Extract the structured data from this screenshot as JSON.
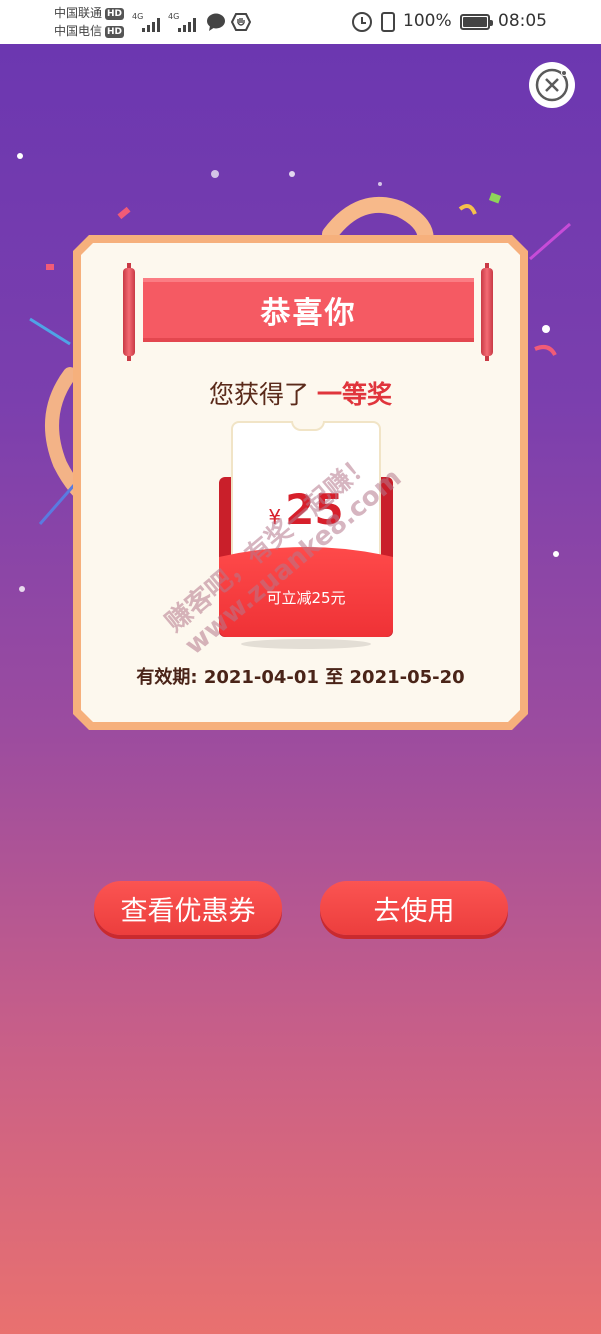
{
  "status_bar": {
    "carrier_1": "中国联通",
    "carrier_2": "中国电信",
    "hd_badge": "HD",
    "network_1": "4G",
    "network_2": "4G",
    "battery_percent": "100%",
    "time": "08:05",
    "icons": [
      "signal-icon",
      "signal-icon",
      "message-icon",
      "shield-icon",
      "alarm-icon",
      "vibrate-icon",
      "battery-icon"
    ]
  },
  "dialog": {
    "banner_title": "恭喜你",
    "prize_prefix": "您获得了",
    "prize_level": "一等奖",
    "coupon": {
      "currency": "¥",
      "amount": "25",
      "caption": "可立减25元"
    },
    "validity_label": "有效期:",
    "validity_start": "2021-04-01",
    "validity_to": "至",
    "validity_end": "2021-05-20"
  },
  "watermark": {
    "line1": "赚客吧，有奖一起赚！",
    "line2": "www.zuanke8.com"
  },
  "actions": {
    "view_coupon": "查看优惠券",
    "use_now": "去使用"
  },
  "colors": {
    "accent_red": "#f55a63",
    "button_red": "#f04543",
    "card_border": "#f6b07c",
    "card_bg": "#fdf8ee"
  }
}
